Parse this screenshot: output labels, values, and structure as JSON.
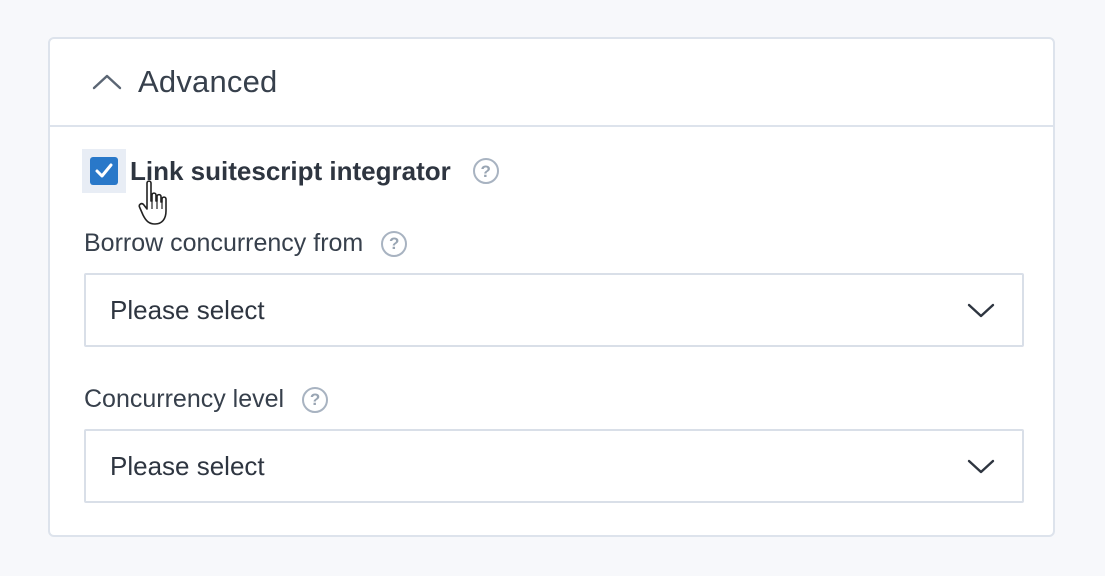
{
  "advanced_section": {
    "title": "Advanced",
    "expanded": true
  },
  "link_suitescript": {
    "label": "Link suitescript integrator",
    "checked": true,
    "help_glyph": "?"
  },
  "borrow_concurrency": {
    "label": "Borrow concurrency from",
    "help_glyph": "?",
    "value": "Please select"
  },
  "concurrency_level": {
    "label": "Concurrency level",
    "help_glyph": "?",
    "value": "Please select"
  },
  "colors": {
    "checkbox_accent": "#2978c9",
    "border": "#dde3ec",
    "text": "#37404c"
  },
  "icons": [
    "chevron-up-icon",
    "checkmark-icon",
    "help-icon",
    "chevron-down-icon",
    "hand-cursor-icon"
  ]
}
